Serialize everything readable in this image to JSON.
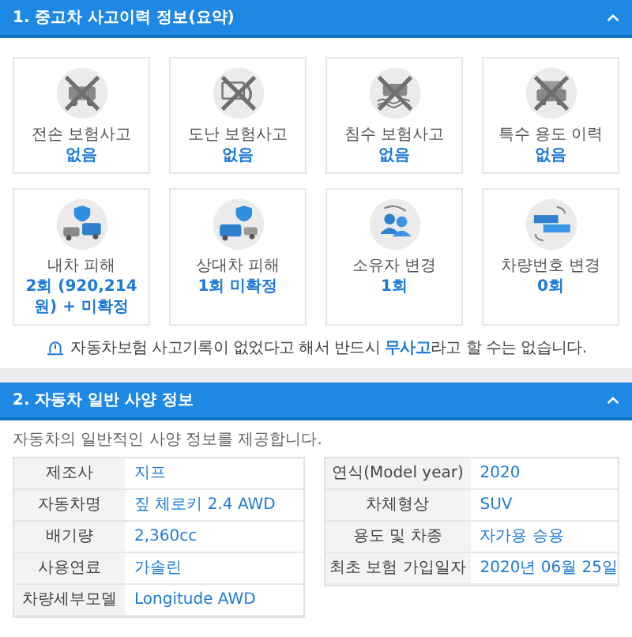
{
  "sections": [
    {
      "title": "1. 중고차 사고이력 정보(요약)",
      "expanded": true,
      "cards": [
        {
          "label": "전손 보험사고",
          "value": "없음",
          "crossed": true
        },
        {
          "label": "도난 보험사고",
          "value": "없음",
          "crossed": true
        },
        {
          "label": "침수 보험사고",
          "value": "없음",
          "crossed": true
        },
        {
          "label": "특수 용도 이력",
          "value": "없음",
          "crossed": true
        },
        {
          "label": "내차 피해",
          "value": "2회 (920,214 원) + 미확정",
          "crossed": false
        },
        {
          "label": "상대차 피해",
          "value": "1회 미확정",
          "crossed": false
        },
        {
          "label": "소유자 변경",
          "value": "1회",
          "crossed": false
        },
        {
          "label": "차량번호 변경",
          "value": "0회",
          "crossed": false
        }
      ],
      "notice": "자동차보험 사고기록이 없었다고 해서 반드시 **무사고**라고 할 수는 없습니다."
    },
    {
      "title": "2. 자동차 일반 사양 정보",
      "expanded": true,
      "description": "자동차의 일반적인 사양 정보를 제공합니다.",
      "tables": [
        [
          {
            "label": "제조사",
            "value": "지프"
          },
          {
            "label": "자동차명",
            "value": "짚 체로키 2.4 AWD"
          },
          {
            "label": "배기량",
            "value": "2,360cc"
          },
          {
            "label": "사용연료",
            "value": "가솔린"
          },
          {
            "label": "차량세부모델",
            "value": "Longitude AWD"
          }
        ],
        [
          {
            "label": "연식(Model year)",
            "value": "2020"
          },
          {
            "label": "차체형상",
            "value": "SUV"
          },
          {
            "label": "용도 및 차종",
            "value": "자가용  승용"
          },
          {
            "label": "최초 보험 가입일자",
            "value": "2020년 06월 25일"
          }
        ]
      ]
    }
  ]
}
